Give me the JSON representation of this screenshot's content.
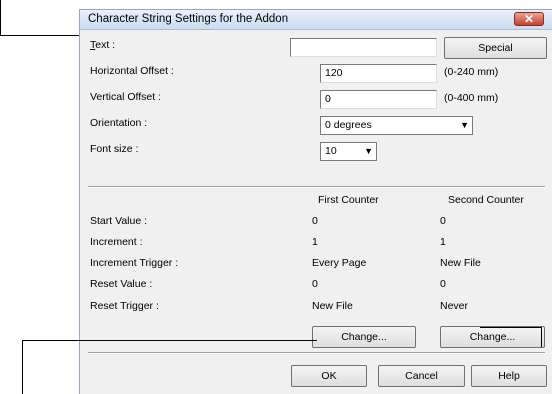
{
  "dialog": {
    "title": "Character String Settings for the Addon",
    "close_glyph": "✕"
  },
  "form": {
    "text_label": "Text :",
    "text_value": "",
    "special_button": "Special",
    "hoffset_label": "Horizontal Offset :",
    "hoffset_value": "120",
    "hoffset_range": "(0-240 mm)",
    "voffset_label": "Vertical Offset :",
    "voffset_value": "0",
    "voffset_range": "(0-400 mm)",
    "orientation_label": "Orientation :",
    "orientation_value": "0 degrees",
    "fontsize_label": "Font size :",
    "fontsize_value": "10"
  },
  "counters": {
    "first_header": "First Counter",
    "second_header": "Second Counter",
    "rows": [
      {
        "label": "Start Value :",
        "first": "0",
        "second": "0"
      },
      {
        "label": "Increment :",
        "first": "1",
        "second": "1"
      },
      {
        "label": "Increment Trigger :",
        "first": "Every Page",
        "second": "New File"
      },
      {
        "label": "Reset Value :",
        "first": "0",
        "second": "0"
      },
      {
        "label": "Reset Trigger :",
        "first": "New File",
        "second": "Never"
      }
    ],
    "change_first": "Change...",
    "change_second": "Change..."
  },
  "footer": {
    "ok": "OK",
    "cancel": "Cancel",
    "help": "Help"
  }
}
